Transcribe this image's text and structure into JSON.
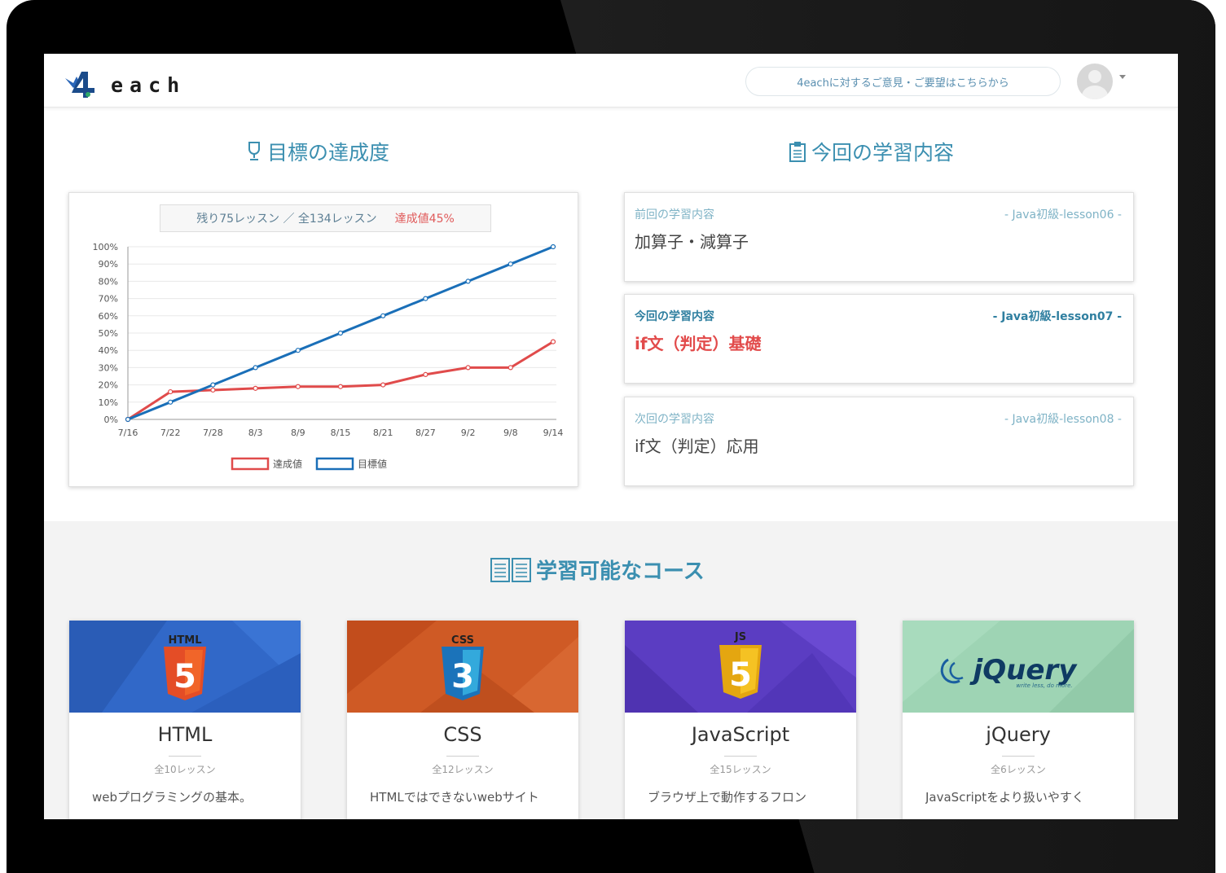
{
  "header": {
    "logo_text": "each",
    "feedback_button": "4eachに対するご意見・ご要望はこちらから"
  },
  "goal_section": {
    "title": "目標の達成度",
    "remaining_text": "残り75レッスン ／ 全134レッスン",
    "achievement_text": "達成値45%"
  },
  "chart_data": {
    "type": "line",
    "x": [
      "7/16",
      "7/22",
      "7/28",
      "8/3",
      "8/9",
      "8/15",
      "8/21",
      "8/27",
      "9/2",
      "9/8",
      "9/14"
    ],
    "ylim": [
      0,
      100
    ],
    "y_ticks": [
      "0%",
      "10%",
      "20%",
      "30%",
      "40%",
      "50%",
      "60%",
      "70%",
      "80%",
      "90%",
      "100%"
    ],
    "grid": true,
    "legend_placement": "bottom",
    "series": [
      {
        "name": "達成値",
        "color": "#e04b4b",
        "values": [
          0,
          16,
          17,
          18,
          19,
          19,
          20,
          26,
          30,
          30,
          45
        ]
      },
      {
        "name": "目標値",
        "color": "#1a6fb8",
        "values": [
          0,
          10,
          20,
          30,
          40,
          50,
          60,
          70,
          80,
          90,
          100
        ]
      }
    ]
  },
  "lesson_section": {
    "title": "今回の学習内容",
    "cards": [
      {
        "label": "前回の学習内容",
        "code": "- Java初級-lesson06 -",
        "title": "加算子・減算子"
      },
      {
        "label": "今回の学習内容",
        "code": "- Java初級-lesson07 -",
        "title": "if文（判定）基礎"
      },
      {
        "label": "次回の学習内容",
        "code": "- Java初級-lesson08 -",
        "title": "if文（判定）応用"
      }
    ]
  },
  "courses_section": {
    "title": "学習可能なコース",
    "courses": [
      {
        "name": "HTML",
        "count": "全10レッスン",
        "desc": "webプログラミングの基本。",
        "badge": "HTML",
        "digit": "5",
        "banner_color": "#3168c8",
        "shield_color": "#e44d26"
      },
      {
        "name": "CSS",
        "count": "全12レッスン",
        "desc": "HTMLではできないwebサイト",
        "badge": "CSS",
        "digit": "3",
        "banner_color": "#cf5a25",
        "shield_color": "#1b73ba"
      },
      {
        "name": "JavaScript",
        "count": "全15レッスン",
        "desc": "ブラウザ上で動作するフロン",
        "badge": "JS",
        "digit": "5",
        "banner_color": "#5b3dc2",
        "shield_color": "#f0b416"
      },
      {
        "name": "jQuery",
        "count": "全6レッスン",
        "desc": "JavaScriptをより扱いやすく",
        "badge": "jQuery",
        "tagline": "write less, do more.",
        "banner_color": "#9ed4b4"
      }
    ]
  }
}
